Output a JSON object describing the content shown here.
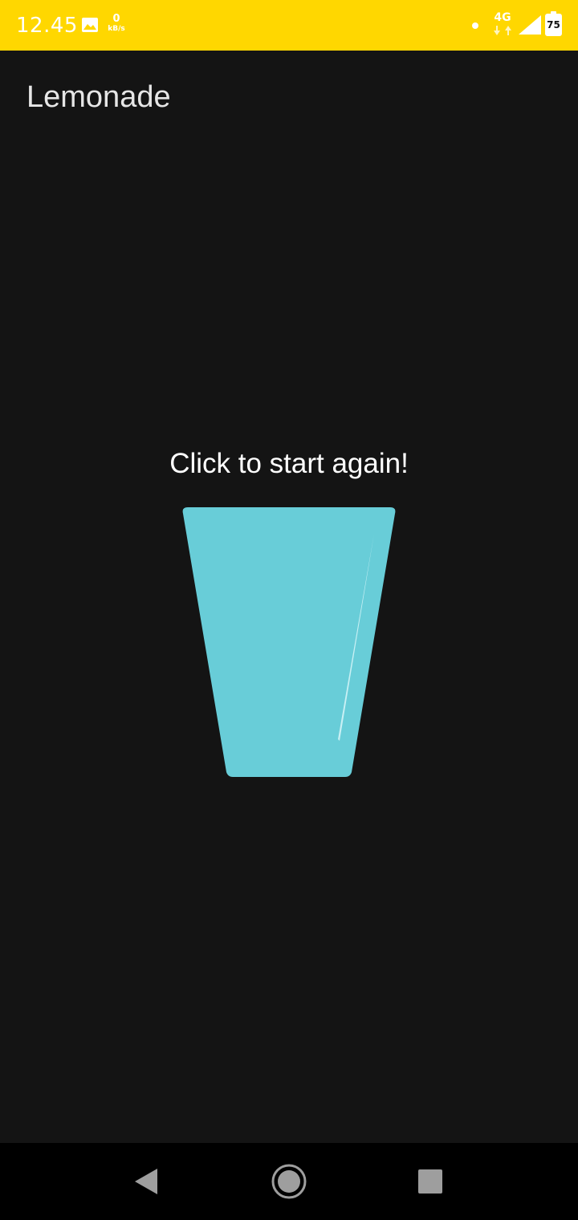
{
  "status_bar": {
    "time": "12.45",
    "net_speed_value": "0",
    "net_speed_unit": "kB/s",
    "network_type": "4G",
    "battery_level": "75",
    "background_color": "#FFD700",
    "icons": [
      "gallery-icon",
      "dot-icon",
      "data-arrows-icon",
      "signal-icon",
      "battery-icon"
    ]
  },
  "app_bar": {
    "title": "Lemonade"
  },
  "main": {
    "prompt": "Click to start again!",
    "image": "empty-glass",
    "image_color": "#68CDD8"
  },
  "nav_bar": {
    "icons": [
      "back-icon",
      "home-icon",
      "recents-icon"
    ]
  }
}
